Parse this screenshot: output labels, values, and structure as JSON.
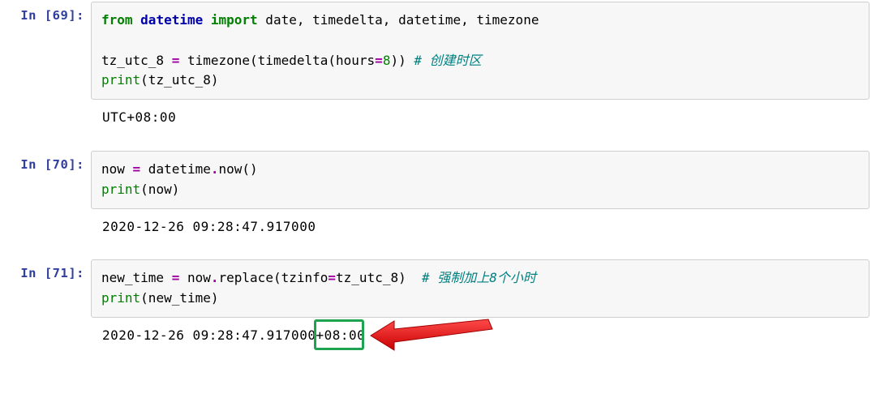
{
  "cells": {
    "c69": {
      "prompt": "In [69]:",
      "code": {
        "import_from": "from",
        "import_mod": "datetime",
        "import_kw": "import",
        "import_names": " date, timedelta, datetime, timezone",
        "l2_var": "tz_utc_8 ",
        "l2_eq": "=",
        "l2_call": " timezone(timedelta(hours",
        "l2_eq2": "=",
        "l2_num": "8",
        "l2_close": ")) ",
        "l2_comment": "# 创建时区",
        "l3_print": "print",
        "l3_arg": "(tz_utc_8)"
      },
      "output": "UTC+08:00"
    },
    "c70": {
      "prompt": "In [70]:",
      "code": {
        "l1_lhs": "now ",
        "l1_eq": "=",
        "l1_rhs": " datetime",
        "l1_dot": ".",
        "l1_fn": "now",
        "l1_par": "()",
        "l2_print": "print",
        "l2_arg": "(now)"
      },
      "output": "2020-12-26 09:28:47.917000"
    },
    "c71": {
      "prompt": "In [71]:",
      "code": {
        "l1_lhs": "new_time ",
        "l1_eq": "=",
        "l1_rhs1": " now",
        "l1_dot": ".",
        "l1_fn": "replace",
        "l1_open": "(tzinfo",
        "l1_eq2": "=",
        "l1_arg": "tz_utc_8)  ",
        "l1_comment": "# 强制加上8个小时",
        "l2_print": "print",
        "l2_arg": "(new_time)"
      },
      "output_pre": "2020-12-26 09:28:47.917000+",
      "output_box": "08:00"
    }
  }
}
